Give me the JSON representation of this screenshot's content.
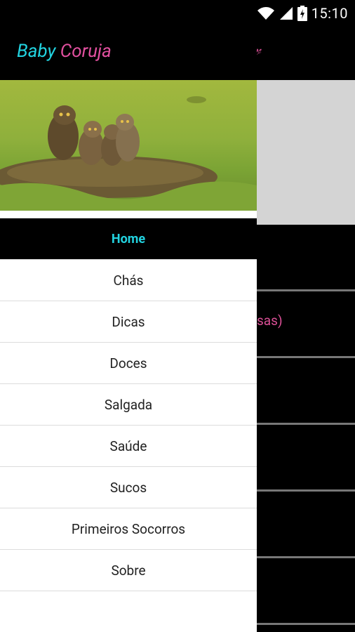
{
  "status_bar": {
    "time": "15:10",
    "icons": [
      "wifi-icon",
      "signal-icon",
      "battery-icon"
    ]
  },
  "app_bar": {
    "title_part1": "Baby",
    "title_part2": "Coruja"
  },
  "background_app": {
    "visible_text": "sas)"
  },
  "drawer": {
    "header_image": "owls-on-grass-photo",
    "items": [
      {
        "label": "Home",
        "active": true
      },
      {
        "label": "Chás",
        "active": false
      },
      {
        "label": "Dicas",
        "active": false
      },
      {
        "label": "Doces",
        "active": false
      },
      {
        "label": "Salgada",
        "active": false
      },
      {
        "label": "Saúde",
        "active": false
      },
      {
        "label": "Sucos",
        "active": false
      },
      {
        "label": "Primeiros Socorros",
        "active": false
      },
      {
        "label": "Sobre",
        "active": false
      }
    ]
  },
  "colors": {
    "accent_cyan": "#22d3e0",
    "accent_pink": "#e2509f",
    "active_bg": "#000000"
  }
}
